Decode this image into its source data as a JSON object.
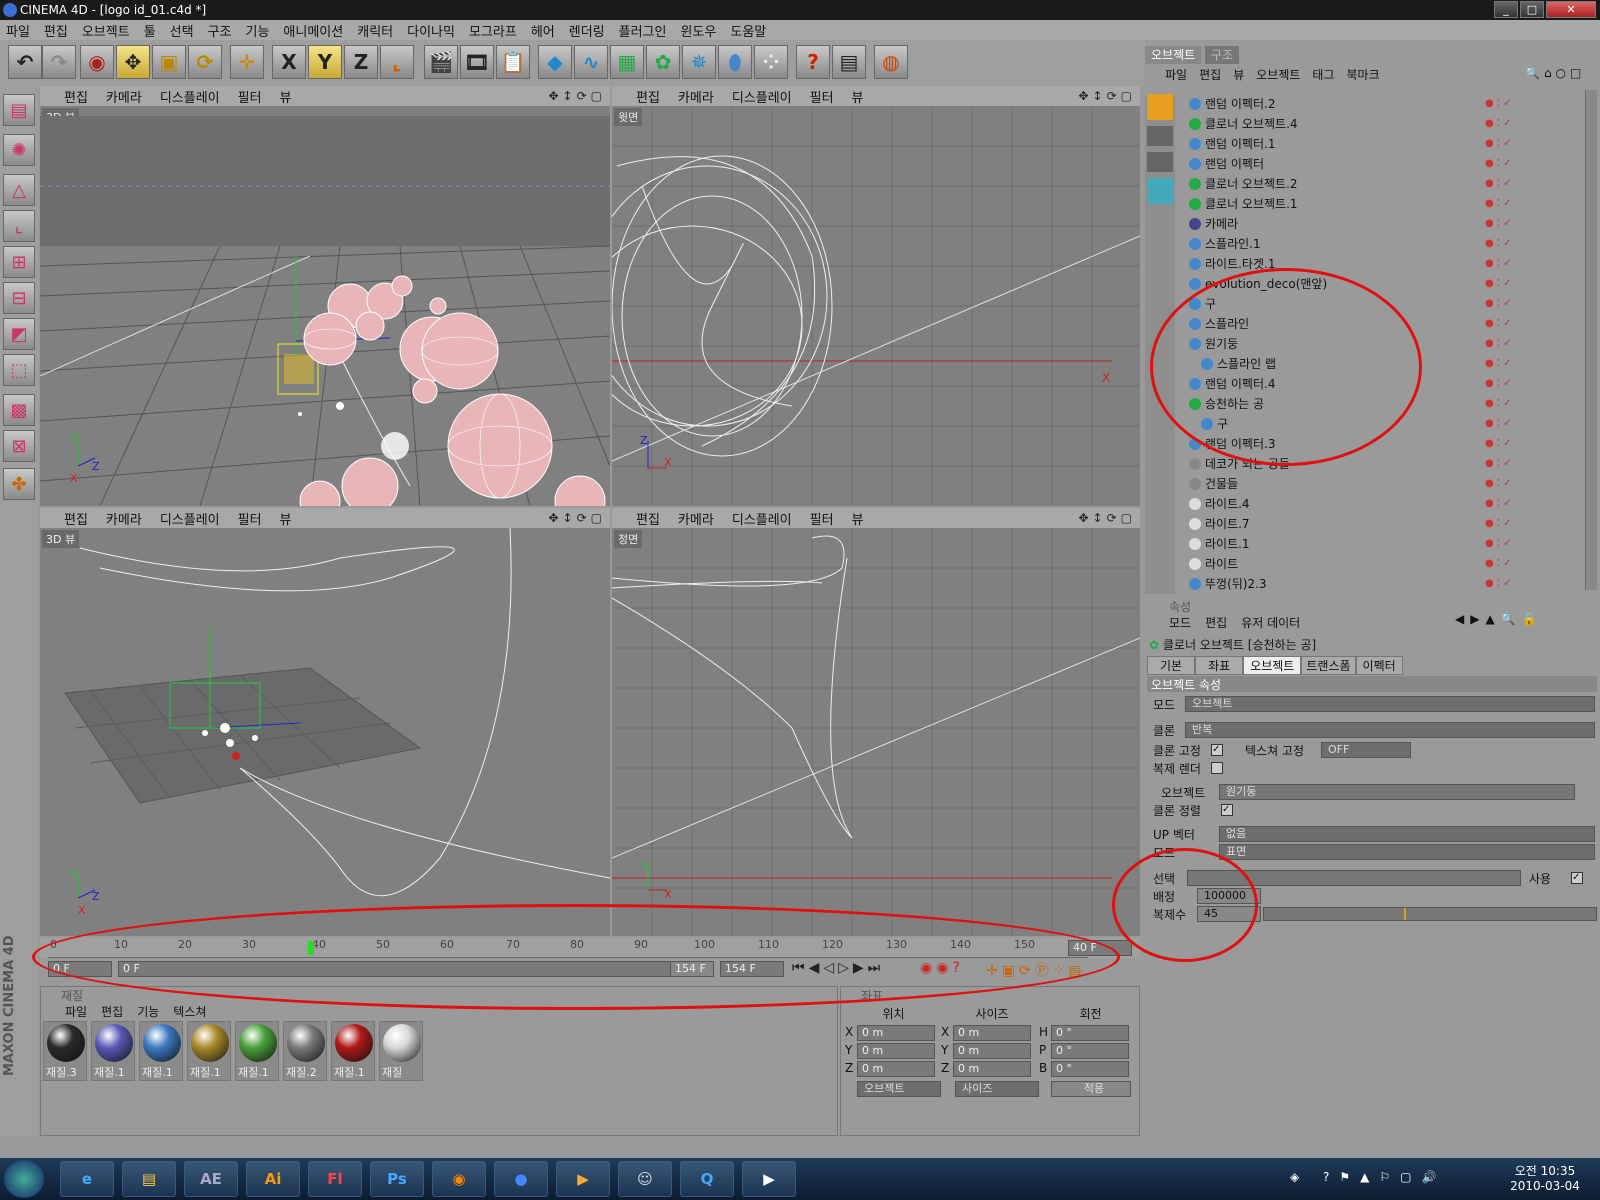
{
  "window": {
    "title": "CINEMA 4D - [logo id_01.c4d *]",
    "controls": [
      "_",
      "□",
      "✕"
    ]
  },
  "menu": [
    "파일",
    "편집",
    "오브젝트",
    "툴",
    "선택",
    "구조",
    "기능",
    "애니메이션",
    "캐릭터",
    "다이나믹",
    "모그라프",
    "헤어",
    "렌더링",
    "플러그인",
    "윈도우",
    "도움말"
  ],
  "toolbar_icons": [
    "undo-icon",
    "redo-icon",
    "live-select-icon",
    "move-icon",
    "scale-icon",
    "rotate-icon",
    "axis-icon",
    "x-axis-icon",
    "y-axis-icon",
    "z-axis-icon",
    "world-coord-icon",
    "render-view-icon",
    "render-picture-icon",
    "render-settings-icon",
    "cube-icon",
    "spline-icon",
    "nurbs-icon",
    "array-icon",
    "deformer-icon",
    "environment-icon",
    "particle-icon",
    "help-icon",
    "layout-icon",
    "web-icon"
  ],
  "toolbar_letters": {
    "x": "X",
    "y": "Y",
    "z": "Z"
  },
  "viewport_menu": [
    "편집",
    "카메라",
    "디스플레이",
    "필터",
    "뷰"
  ],
  "viewports": [
    {
      "name": "3D 뷰"
    },
    {
      "name": "윗면"
    },
    {
      "name": "3D 뷰"
    },
    {
      "name": "정면"
    }
  ],
  "timeline": {
    "ticks": [
      "0",
      "10",
      "20",
      "30",
      "40",
      "50",
      "60",
      "70",
      "80",
      "90",
      "100",
      "110",
      "120",
      "130",
      "140",
      "150"
    ],
    "current": "40 F",
    "start": "0 F",
    "range_start": "0 F",
    "range_end": "154 F",
    "end": "154 F"
  },
  "materials": {
    "title": "재질",
    "menu": [
      "파일",
      "편집",
      "기능",
      "텍스쳐"
    ],
    "items": [
      {
        "name": "재질.3",
        "color": "#2a2a2a"
      },
      {
        "name": "재질.1",
        "color": "#5a5ab8"
      },
      {
        "name": "재질.1",
        "color": "#3b78c0"
      },
      {
        "name": "재질.1",
        "color": "#a88a2a"
      },
      {
        "name": "재질.1",
        "color": "#4aa03a"
      },
      {
        "name": "재질.2",
        "color": "#7a7a7a"
      },
      {
        "name": "재질.1",
        "color": "#b01818"
      },
      {
        "name": "재질",
        "color": "#d8d8d8"
      }
    ]
  },
  "coords": {
    "title": "좌표",
    "headers": [
      "위치",
      "사이즈",
      "회전"
    ],
    "rows": [
      {
        "a": "X",
        "av": "0 m",
        "b": "X",
        "bv": "0 m",
        "c": "H",
        "cv": "0 °"
      },
      {
        "a": "Y",
        "av": "0 m",
        "b": "Y",
        "bv": "0 m",
        "c": "P",
        "cv": "0 °"
      },
      {
        "a": "Z",
        "av": "0 m",
        "b": "Z",
        "bv": "0 m",
        "c": "B",
        "cv": "0 °"
      }
    ],
    "mode1": "오브젝트",
    "mode2": "사이즈",
    "apply": "적용"
  },
  "objmgr": {
    "tabs": [
      "오브젝트",
      "구조"
    ],
    "menu": [
      "파일",
      "편집",
      "뷰",
      "오브젝트",
      "태그",
      "북마크"
    ],
    "items": [
      "랜덤 이펙터.2",
      "클로너 오브젝트.4",
      "랜덤 이펙터.1",
      "랜덤 이펙터",
      "클로너 오브젝트.2",
      "클로너 오브젝트.1",
      "카메라",
      "스플라인.1",
      "라이트.타겟.1",
      "evolution_deco(맨앞)",
      "구",
      "스플라인",
      "원기둥",
      "스플라인 랩",
      "랜덤 이펙터.4",
      "승천하는 공",
      "구",
      "랜덤 이펙터.3",
      "데코가 되는 공들",
      "건물들",
      "라이트.4",
      "라이트.7",
      "라이트.1",
      "라이트",
      "뚜껑(뒤)2.3"
    ]
  },
  "attrmgr": {
    "title": "속성",
    "menu": [
      "모드",
      "편집",
      "유저 데이터"
    ],
    "object": "클로너 오브젝트 [승천하는 공]",
    "tabs": [
      "기본",
      "좌표",
      "오브젝트",
      "트랜스폼",
      "이펙터"
    ],
    "section": "오브젝트 속성",
    "mode_label": "모드",
    "mode_value": "오브젝트",
    "clone_label": "클론",
    "clone_value": "반복",
    "fix_clone_label": "클론 고정",
    "fix_texture_label": "텍스쳐 고정",
    "fix_texture_value": "OFF",
    "instance_label": "복제 렌더",
    "object_label": "오브젝트",
    "object_value": "원기둥",
    "align_label": "클론 정렬",
    "up_label": "UP 벡터",
    "up_value": "없음",
    "mode2_label": "모드",
    "mode2_value": "표면",
    "select_label": "선택",
    "use_label": "사용",
    "seed_label": "배정",
    "seed_value": "100000",
    "count_label": "복제수",
    "count_value": "45"
  },
  "taskbar": {
    "apps": [
      "ie-icon",
      "explorer-icon",
      "AE",
      "Ai",
      "Fl",
      "Ps",
      "firefox-icon",
      "cinema4d-icon",
      "media-icon",
      "messenger-icon",
      "quicktime-icon",
      "live-icon"
    ],
    "time": "오전 10:35",
    "date": "2010-03-04"
  },
  "branding": "MAXON CINEMA 4D"
}
